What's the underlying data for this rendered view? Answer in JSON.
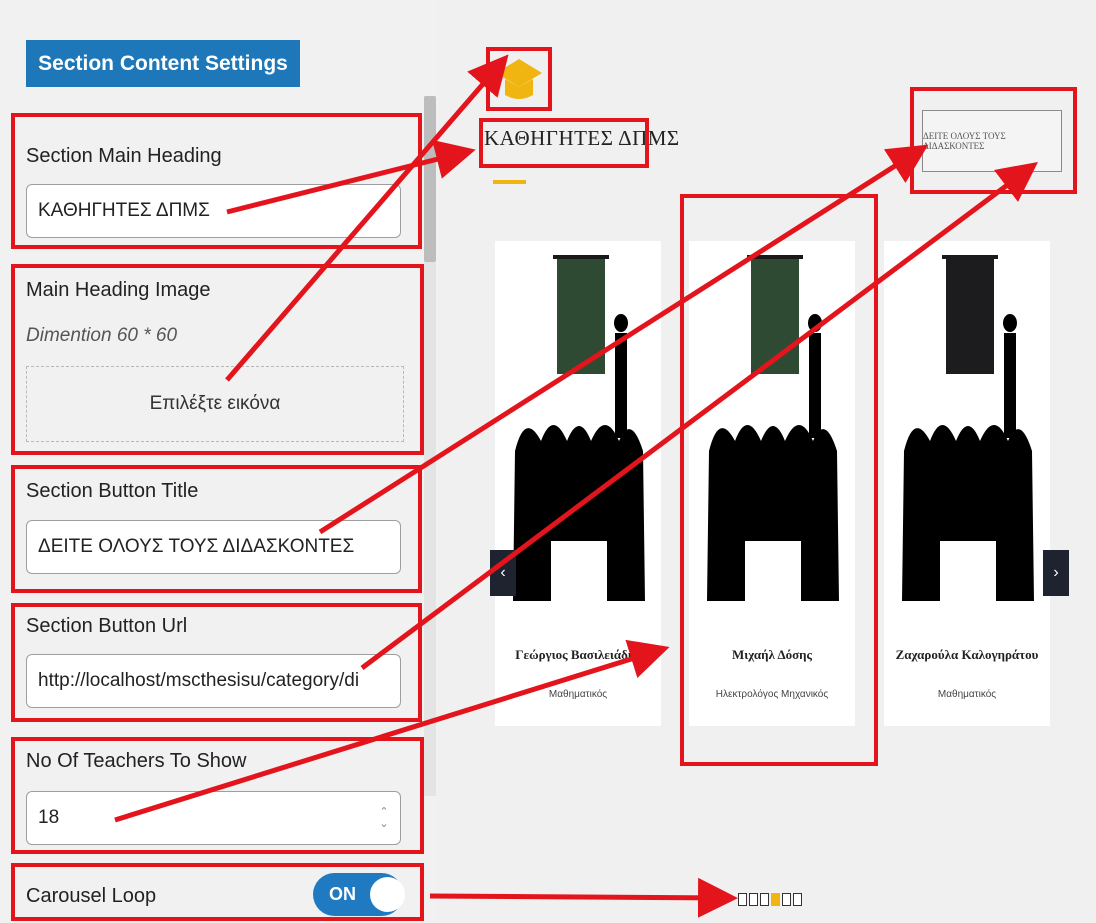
{
  "settings": {
    "tab_label": "Section Content Settings",
    "main_heading": {
      "label": "Section Main Heading",
      "value": "ΚΑΘΗΓΗΤΕΣ ΔΠΜΣ"
    },
    "heading_image": {
      "label": "Main Heading Image",
      "hint": "Dimention 60 * 60",
      "button_label": "Επιλέξτε εικόνα"
    },
    "button_title": {
      "label": "Section Button Title",
      "value": "ΔΕΙΤΕ ΟΛΟΥΣ ΤΟΥΣ ΔΙΔΑΣΚΟΝΤΕΣ"
    },
    "button_url": {
      "label": "Section Button Url",
      "value": "http://localhost/mscthesisu/category/di"
    },
    "teachers_count": {
      "label": "No Of Teachers To Show",
      "value": "18"
    },
    "carousel_loop": {
      "label": "Carousel Loop",
      "toggle_label": "ON",
      "enabled": true
    }
  },
  "preview": {
    "heading": "ΚΑΘΗΓΗΤΕΣ ΔΠΜΣ",
    "see_all_button": "ΔΕΙΤΕ ΟΛΟΥΣ ΤΟΥΣ ΔΙΔΑΣΚΟΝΤΕΣ",
    "teachers": [
      {
        "name": "Γεώργιος Βασιλειάδης",
        "role": "Μαθηματικός"
      },
      {
        "name": "Μιχαήλ Δόσης",
        "role": "Ηλεκτρολόγος Μηχανικός"
      },
      {
        "name": "Ζαχαρούλα Καλογηράτου",
        "role": "Μαθηματικός"
      }
    ],
    "prev_icon": "‹",
    "next_icon": "›",
    "pagination": {
      "total": 6,
      "active": 4
    }
  },
  "colors": {
    "accent_blue": "#1e77b8",
    "highlight_red": "#e3141c",
    "accent_yellow": "#f0b510"
  }
}
